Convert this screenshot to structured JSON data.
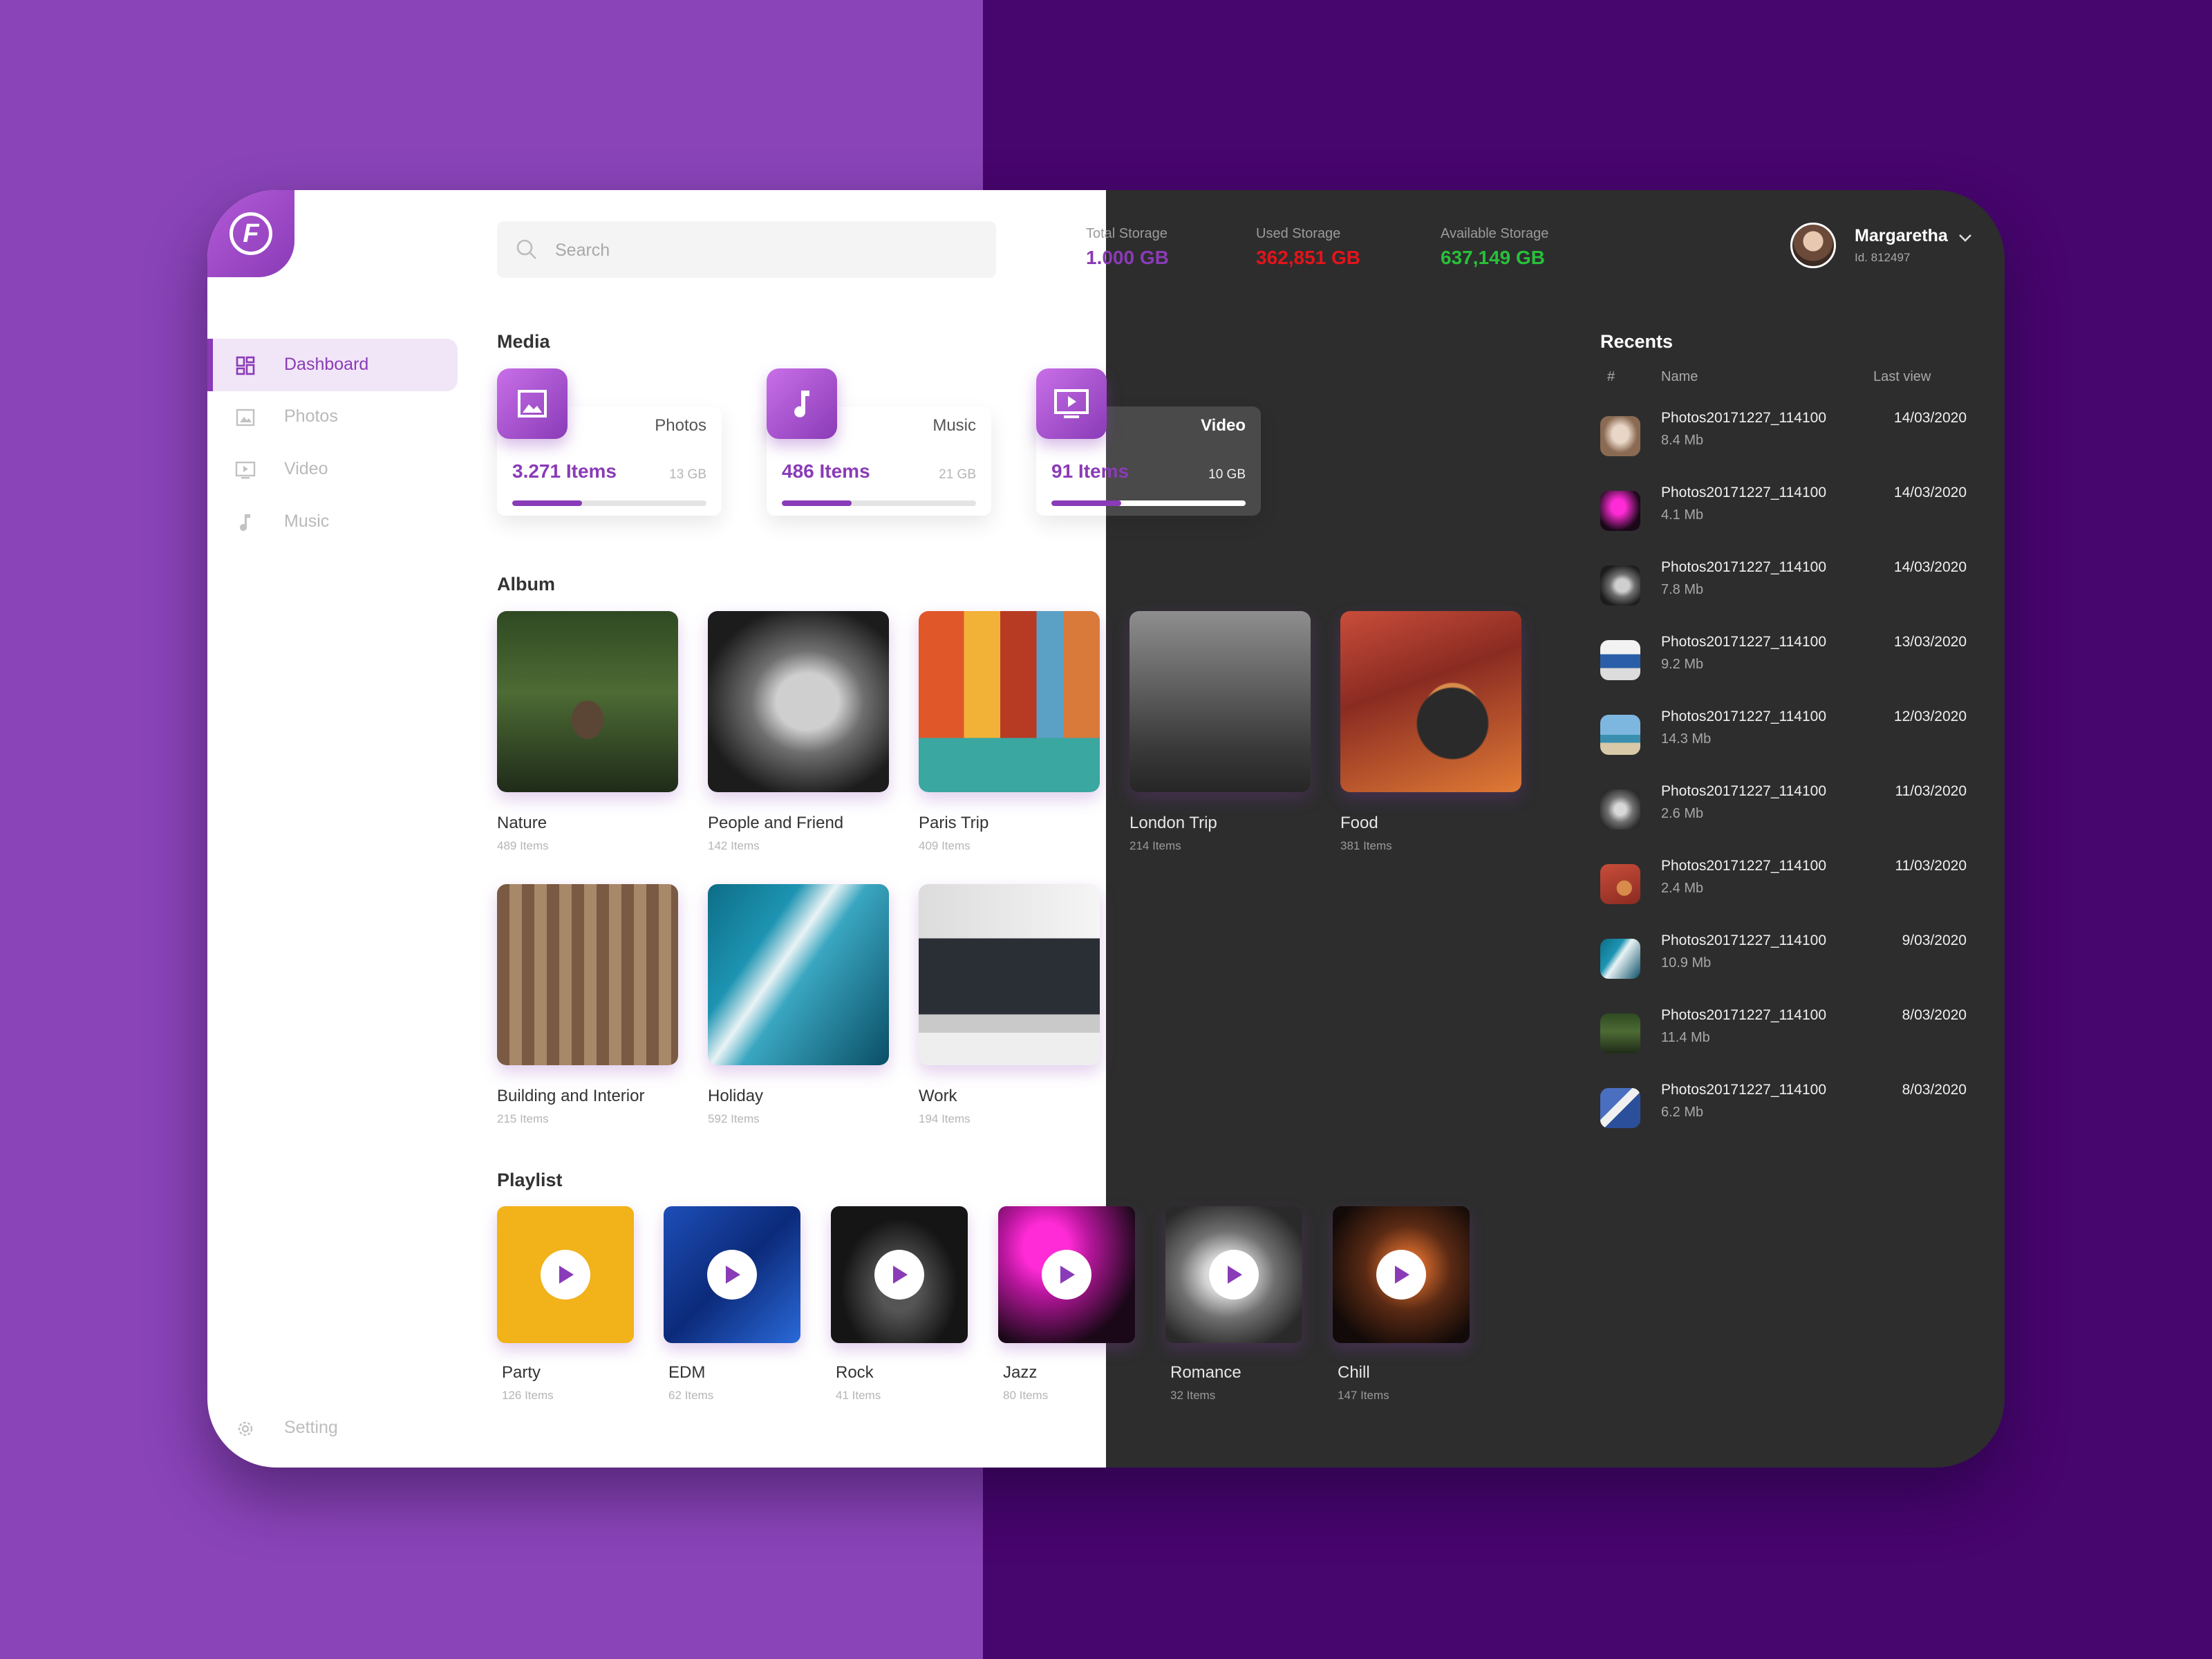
{
  "app": {
    "logo_letter": "F"
  },
  "sidebar": {
    "items": [
      {
        "label": "Dashboard",
        "icon": "dashboard-icon"
      },
      {
        "label": "Photos",
        "icon": "photo-icon"
      },
      {
        "label": "Video",
        "icon": "video-icon"
      },
      {
        "label": "Music",
        "icon": "music-icon"
      }
    ],
    "setting_label": "Setting"
  },
  "search": {
    "placeholder": "Search"
  },
  "storage": {
    "total_label": "Total Storage",
    "total_value": "1.000 GB",
    "used_label": "Used Storage",
    "used_value": "362,851 GB",
    "available_label": "Available Storage",
    "available_value": "637,149 GB"
  },
  "user": {
    "name": "Margaretha",
    "id": "Id. 812497"
  },
  "media": {
    "title": "Media",
    "cards": [
      {
        "name": "Photos",
        "count": "3.271 Items",
        "size": "13 GB",
        "progress": 0.36
      },
      {
        "name": "Music",
        "count": "486 Items",
        "size": "21 GB",
        "progress": 0.36
      },
      {
        "name": "Video",
        "count": "91 Items",
        "size": "10 GB",
        "progress": 0.36
      }
    ]
  },
  "album": {
    "title": "Album",
    "items": [
      {
        "name": "Nature",
        "count": "489 Items"
      },
      {
        "name": "People and Friend",
        "count": "142 Items"
      },
      {
        "name": "Paris Trip",
        "count": "409 Items"
      },
      {
        "name": "London Trip",
        "count": "214 Items"
      },
      {
        "name": "Food",
        "count": "381 Items"
      },
      {
        "name": "Building and  Interior",
        "count": "215 Items"
      },
      {
        "name": "Holiday",
        "count": "592 Items"
      },
      {
        "name": "Work",
        "count": "194 Items"
      }
    ]
  },
  "playlist": {
    "title": "Playlist",
    "items": [
      {
        "name": "Party",
        "count": "126 Items"
      },
      {
        "name": "EDM",
        "count": "62 Items"
      },
      {
        "name": "Rock",
        "count": "41 Items"
      },
      {
        "name": "Jazz",
        "count": "80 Items"
      },
      {
        "name": "Romance",
        "count": "32 Items"
      },
      {
        "name": "Chill",
        "count": "147 Items"
      }
    ]
  },
  "recents": {
    "title": "Recents",
    "col_num": "#",
    "col_name": "Name",
    "col_last": "Last view",
    "rows": [
      {
        "name": "Photos20171227_114100",
        "size": "8.4 Mb",
        "date": "14/03/2020"
      },
      {
        "name": "Photos20171227_114100",
        "size": "4.1 Mb",
        "date": "14/03/2020"
      },
      {
        "name": "Photos20171227_114100",
        "size": "7.8 Mb",
        "date": "14/03/2020"
      },
      {
        "name": "Photos20171227_114100",
        "size": "9.2 Mb",
        "date": "13/03/2020"
      },
      {
        "name": "Photos20171227_114100",
        "size": "14.3 Mb",
        "date": "12/03/2020"
      },
      {
        "name": "Photos20171227_114100",
        "size": "2.6 Mb",
        "date": "11/03/2020"
      },
      {
        "name": "Photos20171227_114100",
        "size": "2.4 Mb",
        "date": "11/03/2020"
      },
      {
        "name": "Photos20171227_114100",
        "size": "10.9 Mb",
        "date": "9/03/2020"
      },
      {
        "name": "Photos20171227_114100",
        "size": "11.4 Mb",
        "date": "8/03/2020"
      },
      {
        "name": "Photos20171227_114100",
        "size": "6.2 Mb",
        "date": "8/03/2020"
      }
    ]
  },
  "colors": {
    "accent": "#8a3bb7",
    "used": "#e3141b",
    "available": "#27c13a",
    "dark_bg": "#2d2d2d"
  }
}
